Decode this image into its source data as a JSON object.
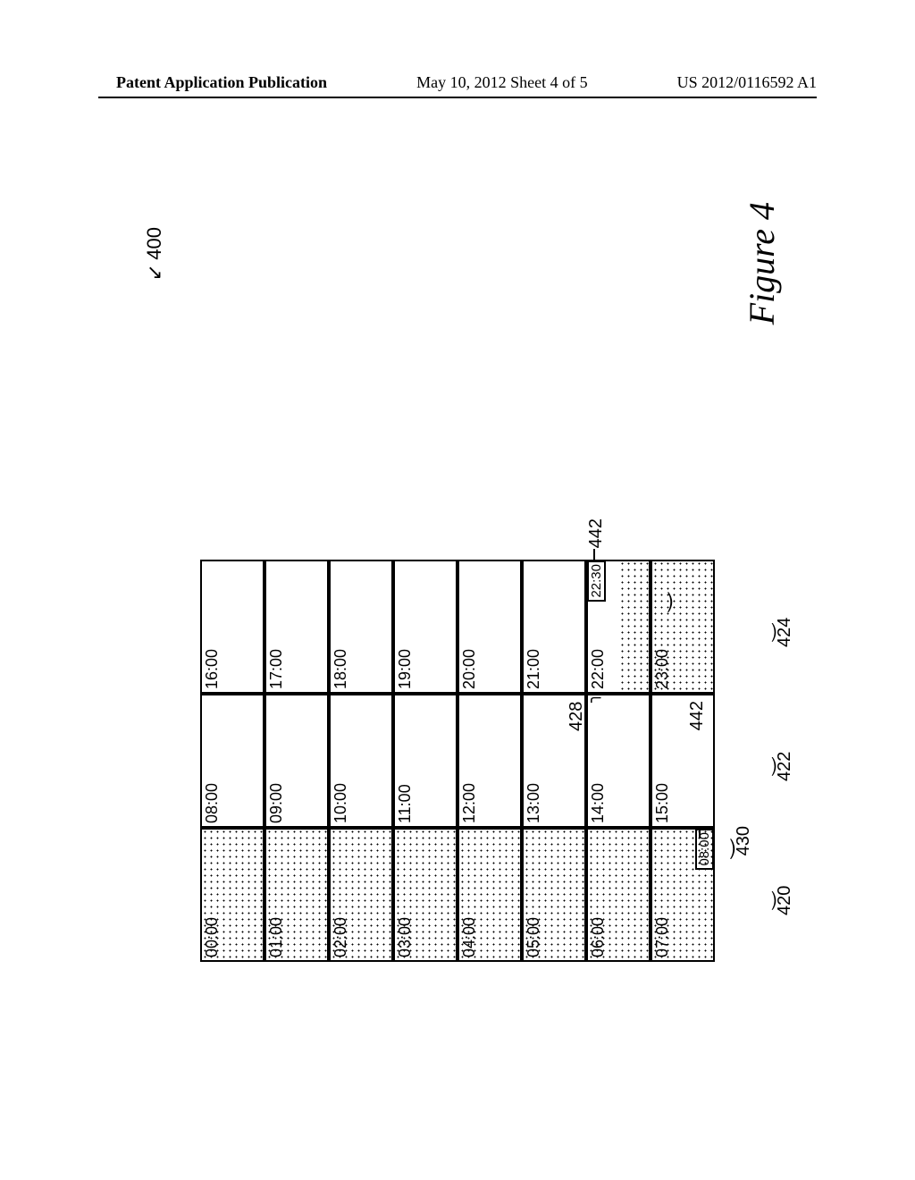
{
  "header": {
    "left": "Patent Application Publication",
    "center": "May 10, 2012  Sheet 4 of 5",
    "right": "US 2012/0116592 A1"
  },
  "figure": {
    "caption": "Figure 4",
    "ref_main": "400",
    "columns": {
      "c1": [
        "00:00",
        "01:00",
        "02:00",
        "03:00",
        "04:00",
        "05:00",
        "06:00",
        "07:00"
      ],
      "c2": [
        "08:00",
        "09:00",
        "10:00",
        "11:00",
        "12:00",
        "13:00",
        "14:00",
        "15:00"
      ],
      "c3": [
        "16:00",
        "17:00",
        "18:00",
        "19:00",
        "20:00",
        "21:00",
        "22:00",
        "23:00"
      ]
    },
    "sliders": {
      "morning_end": "08:00",
      "evening_start": "22:30"
    },
    "refs": {
      "col1_bottom": "420",
      "col2_bottom": "422",
      "col3_bottom": "424",
      "cell_22": "428",
      "slider_morning": "442",
      "slider_evening": "442",
      "brace_morning": "430"
    }
  }
}
